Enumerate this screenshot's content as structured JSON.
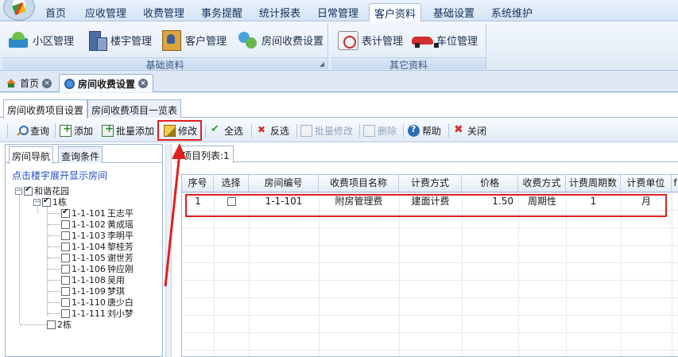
{
  "menu": {
    "items": [
      "首页",
      "应收管理",
      "收费管理",
      "事务提醒",
      "统计报表",
      "日常管理",
      "客户资料",
      "基础设置",
      "系统维护"
    ],
    "active": "客户资料"
  },
  "ribbon": {
    "groups": [
      {
        "caption": "基础资料",
        "buttons": [
          "小区管理",
          "楼宇管理",
          "客户管理",
          "房间收费设置"
        ]
      },
      {
        "caption": "其它资料",
        "buttons": [
          "表计管理",
          "车位管理"
        ]
      }
    ]
  },
  "doc_tabs": [
    {
      "label": "首页"
    },
    {
      "label": "房间收费设置"
    }
  ],
  "inner_tabs": [
    "房间收费项目设置",
    "房间收费项目一览表"
  ],
  "toolbar": {
    "query": "查询",
    "add": "添加",
    "batch_add": "批量添加",
    "edit": "修改",
    "select_all": "全选",
    "invert": "反选",
    "batch_edit": "批量修改",
    "delete": "删除",
    "help": "帮助",
    "close": "关闭"
  },
  "left_panel": {
    "tabs": [
      "房间导航",
      "查询条件"
    ],
    "hint": "点击楼宇展开显示房间",
    "tree": {
      "root": "和谐花园",
      "building1": "1栋",
      "rooms": [
        {
          "code": "1-1-101",
          "name": "王志平",
          "checked": true
        },
        {
          "code": "1-1-102",
          "name": "黄成瑶",
          "checked": false
        },
        {
          "code": "1-1-103",
          "name": "李明平",
          "checked": false
        },
        {
          "code": "1-1-104",
          "name": "黎桂芳",
          "checked": false
        },
        {
          "code": "1-1-105",
          "name": "谢世芳",
          "checked": false
        },
        {
          "code": "1-1-106",
          "name": "钟应刚",
          "checked": false
        },
        {
          "code": "1-1-108",
          "name": "吴用",
          "checked": false
        },
        {
          "code": "1-1-109",
          "name": "梦琪",
          "checked": false
        },
        {
          "code": "1-1-110",
          "name": "唐少白",
          "checked": false
        },
        {
          "code": "1-1-111",
          "name": "刘小梦",
          "checked": false
        }
      ],
      "building2": "2栋"
    }
  },
  "right_panel": {
    "tab": "项目列表:1",
    "columns": [
      "序号",
      "选择",
      "房间编号",
      "收费项目名称",
      "计费方式",
      "价格",
      "收费方式",
      "计费周期数",
      "计费单位",
      "f"
    ],
    "rows": [
      [
        "1",
        "",
        "1-1-101",
        "附房管理费",
        "建面计费",
        "1.50",
        "周期性",
        "1",
        "月",
        ""
      ]
    ]
  },
  "colors": {
    "highlight": "#e02020",
    "link": "#1f4fbf"
  }
}
